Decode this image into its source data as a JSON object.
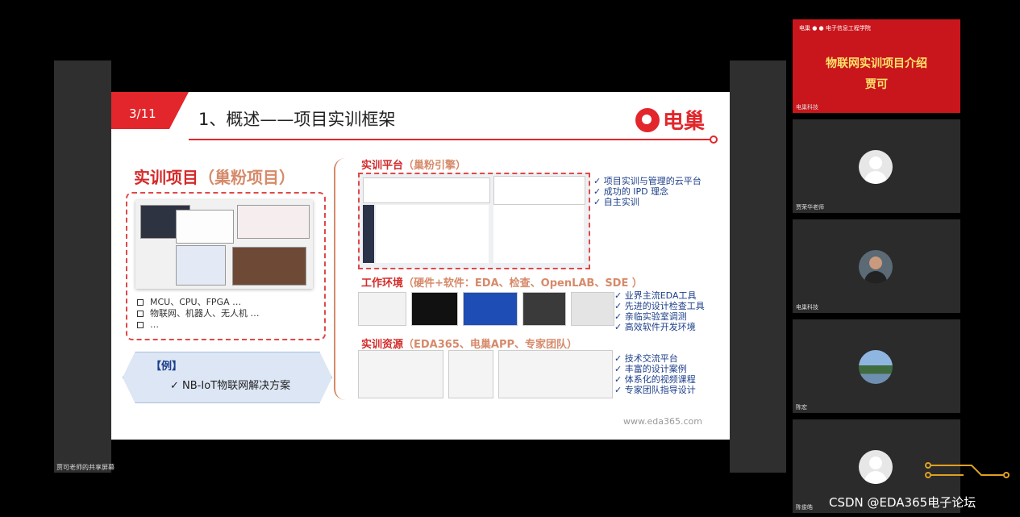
{
  "share": {
    "label": "贾可老师的共享屏幕"
  },
  "slide": {
    "page": "3/11",
    "title": "1、概述——项目实训框架",
    "logo_text": "电巢",
    "project_title": "实训项目",
    "project_sub": "（巢粉项目）",
    "bullets": [
      "MCU、CPU、FPGA …",
      "物联网、机器人、无人机 …",
      "…"
    ],
    "example_head": "【例】",
    "example_item": "✓  NB-IoT物联网解决方案",
    "sections": [
      {
        "title": "实训平台",
        "sub": "（巢粉引擎）",
        "checks": [
          "✓  项目实训与管理的云平台",
          "✓  成功的 IPD 理念",
          "✓  自主实训"
        ]
      },
      {
        "title": "工作环境",
        "sub": "（硬件+软件：EDA、检查、OpenLAB、SDE ）",
        "checks": [
          "✓  业界主流EDA工具",
          "✓  先进的设计检查工具",
          "✓  亲临实验室调测",
          "✓  高效软件开发环境"
        ]
      },
      {
        "title": "实训资源",
        "sub": "（EDA365、电巢APP、专家团队）",
        "checks": [
          "✓  技术交流平台",
          "✓  丰富的设计案例",
          "✓  体系化的视频课程",
          "✓  专家团队指导设计"
        ]
      }
    ],
    "site": "www.eda365.com"
  },
  "participants": {
    "banner": {
      "top": "电巢  ●  ● 电子信息工程学院",
      "title": "物联网实训项目介绍",
      "name": "贾可",
      "label": "电巢科技"
    },
    "tiles": [
      {
        "label": "贾荣华老师"
      },
      {
        "label": "电巢科技"
      },
      {
        "label": "陈宏"
      },
      {
        "label": "陈俊皓"
      }
    ]
  },
  "watermark": "CSDN @EDA365电子论坛"
}
